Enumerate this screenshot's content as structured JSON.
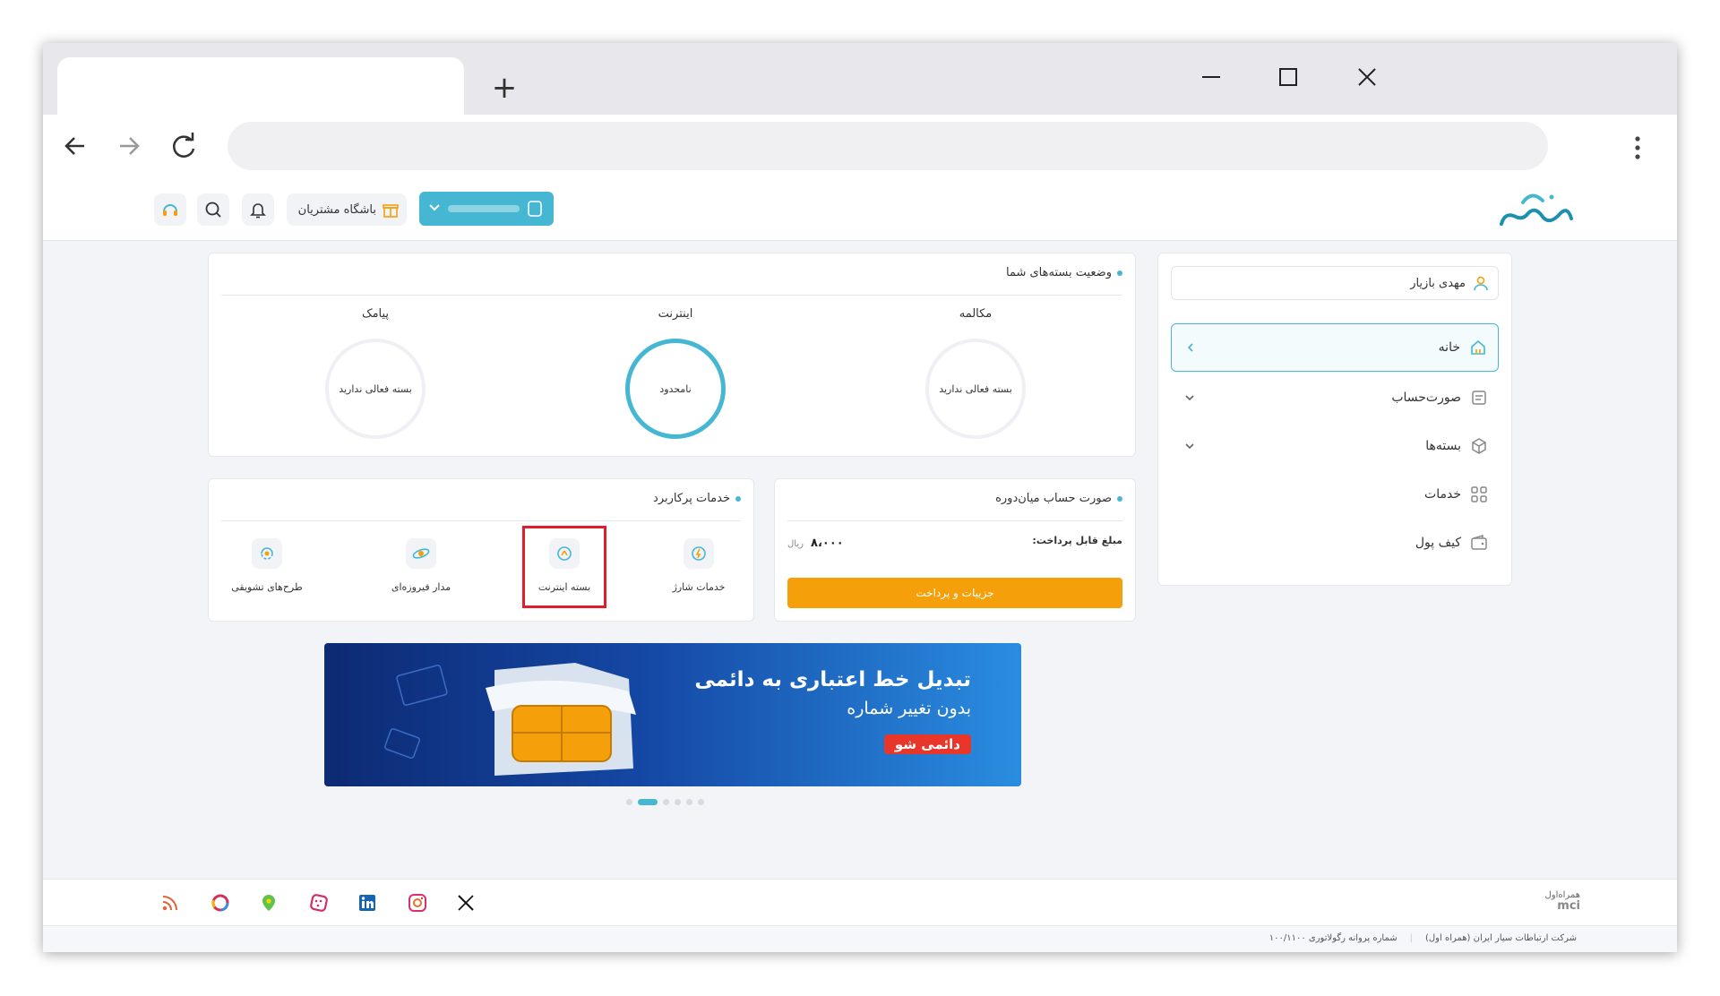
{
  "browser": {
    "new_tab_symbol": "+"
  },
  "header": {
    "club_label": "باشگاه مشتریان"
  },
  "packages": {
    "title": "وضعیت بسته‌های شما",
    "items": [
      {
        "label": "مکالمه",
        "status": "بسته فعالی ندارید"
      },
      {
        "label": "اینترنت",
        "status": "نامحدود"
      },
      {
        "label": "پیامک",
        "status": "بسته فعالی ندارید"
      }
    ]
  },
  "bill": {
    "title": "صورت حساب میان‌دوره",
    "amount_label": "مبلغ قابل پرداخت:",
    "amount_value": "۸،۰۰۰",
    "currency": "ریال",
    "pay_button": "جزییات و پرداخت"
  },
  "services": {
    "title": "خدمات پرکاربرد",
    "items": [
      {
        "label": "خدمات شارژ",
        "icon": "charge-icon"
      },
      {
        "label": "بسته اینترنت",
        "icon": "internet-package-icon",
        "highlighted": true
      },
      {
        "label": "مدار فیروزه‌ای",
        "icon": "turquoise-orbit-icon"
      },
      {
        "label": "طرح‌های تشویقی",
        "icon": "incentive-icon"
      }
    ]
  },
  "sidebar": {
    "user_name": "مهدی بازیار",
    "items": [
      {
        "label": "خانه",
        "icon": "home-icon",
        "active": true
      },
      {
        "label": "صورت‌حساب",
        "icon": "bill-icon",
        "expandable": true
      },
      {
        "label": "بسته‌ها",
        "icon": "package-icon",
        "expandable": true
      },
      {
        "label": "خدمات",
        "icon": "services-grid-icon"
      },
      {
        "label": "کیف پول",
        "icon": "wallet-icon"
      }
    ]
  },
  "banner": {
    "headline": "تبدیل خط اعتباری به دائمی",
    "subline": "بدون تغییر شماره",
    "cta": "دائمی شو",
    "slides_total": 6,
    "active_slide": 2
  },
  "footer": {
    "company": "شرکت ارتباطات سیار ایران (همراه اول)",
    "license": "شماره پروانه رگولاتوری ۱۰۰/۱۱۰۰",
    "brand": "همراه‌اول",
    "brand_latin": "mci",
    "social_icons": [
      "rss-icon",
      "aparat-icon",
      "neshan-icon",
      "bale-icon",
      "linkedin-icon",
      "instagram-icon",
      "x-icon"
    ]
  },
  "colors": {
    "accent": "#46b7d2",
    "pay_button": "#f5a00a",
    "highlight_border": "#e01e2b",
    "banner_cta": "#e8362b"
  }
}
